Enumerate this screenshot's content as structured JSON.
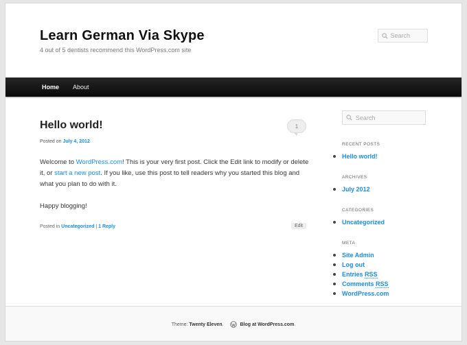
{
  "header": {
    "site_title": "Learn German Via Skype",
    "site_description": "4 out of 5 dentists recommend this WordPress.com site",
    "search_placeholder": "Search"
  },
  "nav": {
    "items": [
      {
        "label": "Home"
      },
      {
        "label": "About"
      }
    ]
  },
  "post": {
    "title": "Hello world!",
    "comment_count": "1",
    "meta_prefix": "Posted on",
    "meta_date": "July 4, 2012",
    "content": {
      "p1_text1": "Welcome to ",
      "p1_link1": "WordPress.com",
      "p1_text2": "! This is your very first post. Click the Edit link to modify or delete it, or ",
      "p1_link2": "start a new post",
      "p1_text3": ". If you like, use this post to tell readers why you started this blog and what you plan to do with it.",
      "p2": "Happy blogging!"
    },
    "utility_prefix": "Posted in",
    "category": "Uncategorized",
    "separator": "|",
    "reply": "1 Reply",
    "edit": "Edit"
  },
  "sidebar": {
    "search_placeholder": "Search",
    "recent_posts": {
      "title": "RECENT POSTS",
      "items": [
        "Hello world!"
      ]
    },
    "archives": {
      "title": "ARCHIVES",
      "items": [
        "July 2012"
      ]
    },
    "categories": {
      "title": "CATEGORIES",
      "items": [
        "Uncategorized"
      ]
    },
    "meta": {
      "title": "META",
      "site_admin": "Site Admin",
      "log_out": "Log out",
      "entries": "Entries",
      "comments": "Comments",
      "rss": "RSS",
      "wordpress": "WordPress.com"
    }
  },
  "footer": {
    "theme_prefix": "Theme:",
    "theme_name": "Twenty Eleven",
    "period": ".",
    "blog_at": "Blog at WordPress.com"
  },
  "colors": {
    "link": "#1b8be0",
    "nav_bg": "#111111"
  },
  "icons": {
    "search": "search-icon",
    "wordpress": "wordpress-logo-icon"
  }
}
